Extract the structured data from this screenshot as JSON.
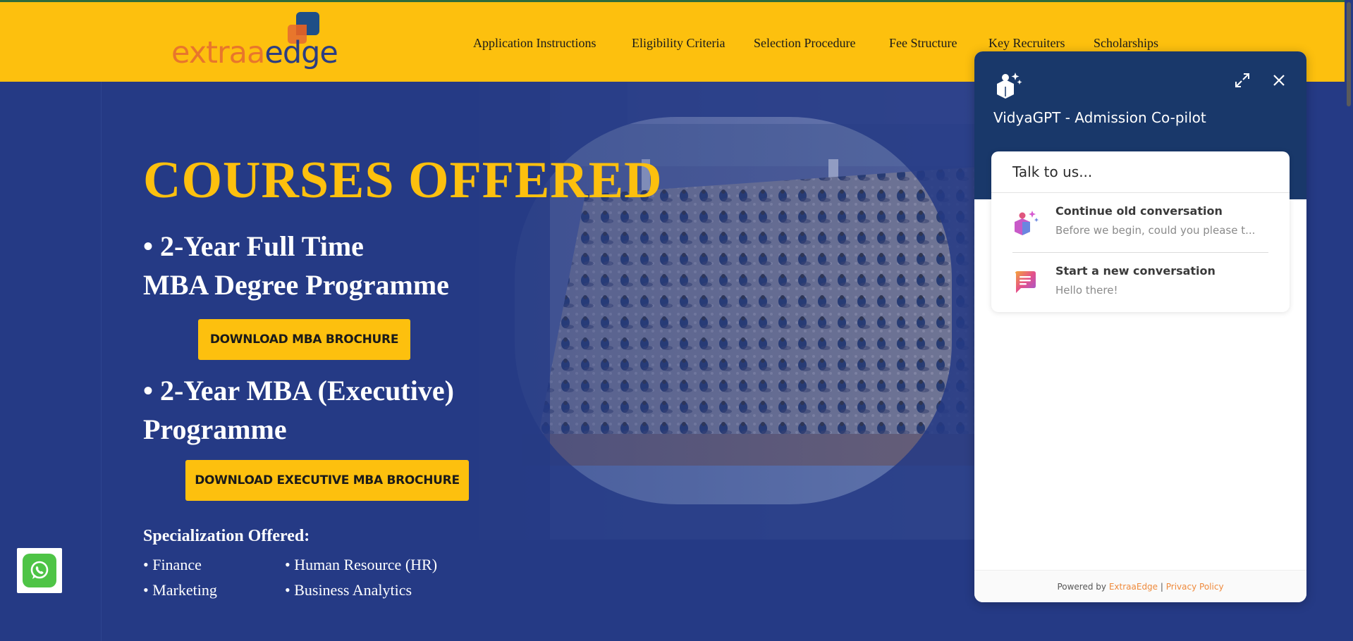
{
  "header": {
    "logo": {
      "part1": "extraa",
      "part2": "edge"
    },
    "nav": [
      {
        "label": "Application Instructions"
      },
      {
        "label": "Eligibility Criteria"
      },
      {
        "label": "Selection Procedure"
      },
      {
        "label": "Fee Structure"
      },
      {
        "label": "Key Recruiters"
      },
      {
        "label": "Scholarships"
      }
    ]
  },
  "hero": {
    "title": "COURSES OFFERED",
    "course1": {
      "line1": "• 2-Year Full Time",
      "line2": "MBA Degree Programme",
      "button": "DOWNLOAD MBA BROCHURE"
    },
    "course2": {
      "line1": "• 2-Year MBA (Executive)",
      "line2": "Programme",
      "button": "DOWNLOAD EXECUTIVE MBA BROCHURE"
    },
    "specialization_title": "Specialization Offered:",
    "specializations": [
      "• Finance",
      "• Human Resource (HR)",
      "• Marketing",
      "• Business Analytics"
    ]
  },
  "chat": {
    "title": "VidyaGPT - Admission Co-pilot",
    "card_heading": "Talk to us...",
    "conversations": [
      {
        "title": "Continue old conversation",
        "subtitle": "Before we begin, could you please t..."
      },
      {
        "title": "Start a new conversation",
        "subtitle": "Hello there!"
      }
    ],
    "footer": {
      "powered_by": "Powered by",
      "brand": "ExtraaEdge",
      "sep": "|",
      "privacy": "Privacy Policy"
    }
  },
  "colors": {
    "brand_yellow": "#fdc00e",
    "hero_blue": "#253a85",
    "chat_navy": "#19386a",
    "whatsapp_green": "#4ec446",
    "link_orange": "#ef8a3c"
  },
  "icons": [
    "logo-mark-icon",
    "whatsapp-icon",
    "chat-bot-icon",
    "expand-icon",
    "close-icon",
    "conversation-history-icon",
    "new-chat-icon"
  ]
}
